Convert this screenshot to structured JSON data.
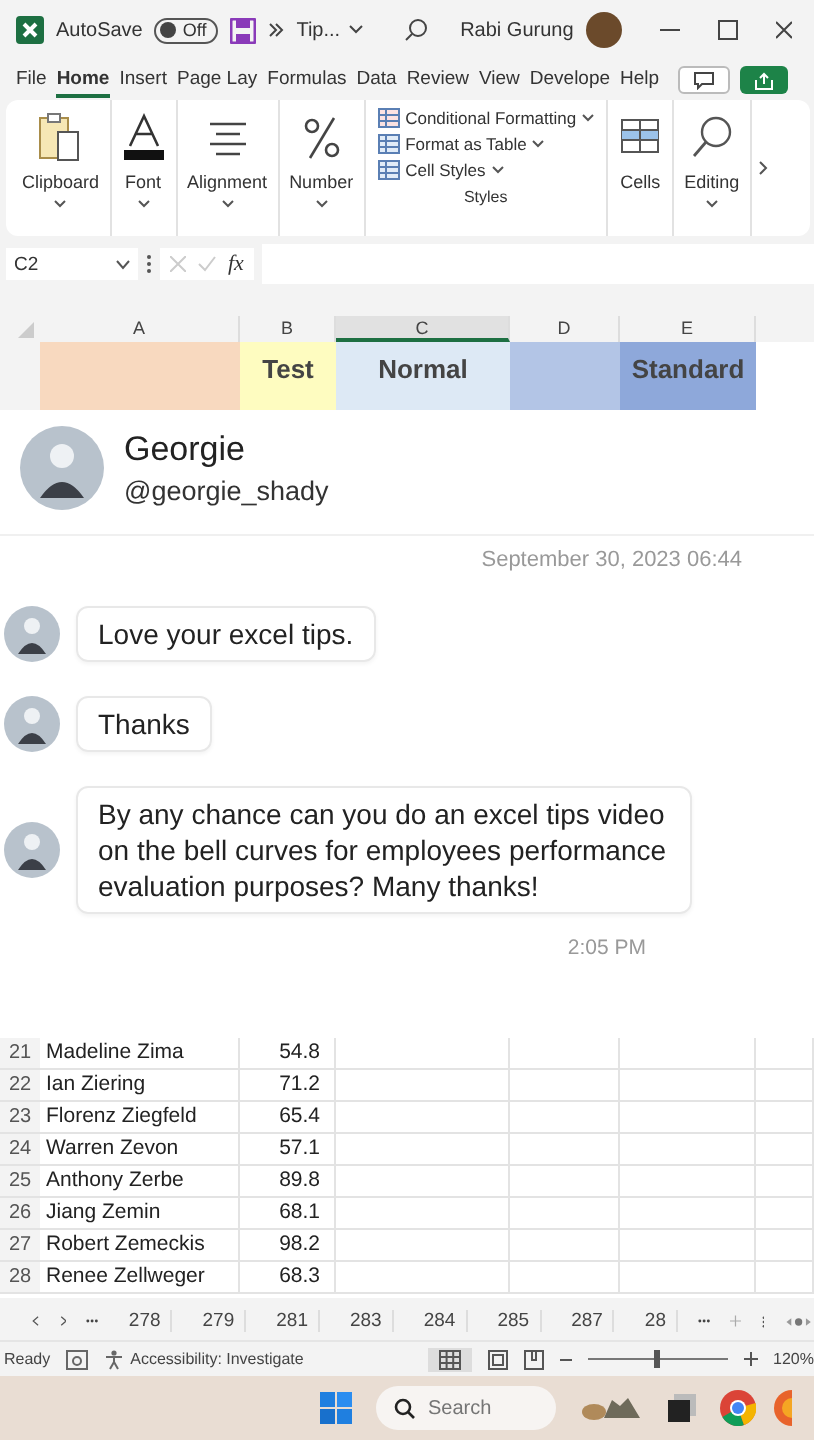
{
  "titlebar": {
    "autosave_label": "AutoSave",
    "autosave_toggle": {
      "label": "Off",
      "on": false
    },
    "filename": "Tip...",
    "user": "Rabi Gurung"
  },
  "menu_tabs": [
    {
      "label": "File",
      "selected": false
    },
    {
      "label": "Home",
      "selected": true
    },
    {
      "label": "Insert",
      "selected": false
    },
    {
      "label": "Page Lay",
      "selected": false
    },
    {
      "label": "Formulas",
      "selected": false
    },
    {
      "label": "Data",
      "selected": false
    },
    {
      "label": "Review",
      "selected": false
    },
    {
      "label": "View",
      "selected": false
    },
    {
      "label": "Develope",
      "selected": false
    },
    {
      "label": "Help",
      "selected": false
    }
  ],
  "ribbon": {
    "groups": [
      {
        "kind": "clipboard",
        "label": "Clipboard"
      },
      {
        "kind": "font",
        "label": "Font"
      },
      {
        "kind": "alignment",
        "label": "Alignment"
      },
      {
        "kind": "number",
        "label": "Number"
      }
    ],
    "styles": {
      "items": [
        "Conditional Formatting",
        "Format as Table",
        "Cell Styles"
      ],
      "label": "Styles"
    },
    "cells": "Cells",
    "editing": "Editing"
  },
  "formula_bar": {
    "name_box": "C2",
    "fx": "fx"
  },
  "sheet": {
    "columns": [
      {
        "label": "A",
        "selected": false
      },
      {
        "label": "B",
        "selected": false
      },
      {
        "label": "C",
        "selected": true
      },
      {
        "label": "D",
        "selected": false
      },
      {
        "label": "E",
        "selected": false
      }
    ],
    "header_row": {
      "cells": [
        {
          "color": "#f8d9bf"
        },
        {
          "text": "Test",
          "color": "#fefcc0"
        },
        {
          "text": "Normal",
          "color": "#dde9f5"
        },
        {
          "color": "#b3c5e6"
        },
        {
          "text": "Standard",
          "color": "#8ea8da"
        }
      ]
    },
    "rows": [
      {
        "number": "21",
        "name": "Madeline Zima",
        "value": "54.8"
      },
      {
        "number": "22",
        "name": "Ian Ziering",
        "value": "71.2"
      },
      {
        "number": "23",
        "name": "Florenz Ziegfeld",
        "value": "65.4"
      },
      {
        "number": "24",
        "name": "Warren Zevon",
        "value": "57.1"
      },
      {
        "number": "25",
        "name": "Anthony Zerbe",
        "value": "89.8"
      },
      {
        "number": "26",
        "name": "Jiang Zemin",
        "value": "68.1"
      },
      {
        "number": "27",
        "name": "Robert Zemeckis",
        "value": "98.2"
      },
      {
        "number": "28",
        "name": "Renee Zellweger",
        "value": "68.3"
      }
    ]
  },
  "chat": {
    "name": "Georgie",
    "handle": "@georgie_shady",
    "date": "September 30, 2023 06:44",
    "messages": [
      "Love your excel tips.",
      "Thanks",
      "By any chance can you do an excel tips video on the bell curves for employees performance evaluation purposes? Many thanks!"
    ],
    "time": "2:05 PM"
  },
  "sheet_tabs": [
    "278",
    "279",
    "281",
    "283",
    "284",
    "285",
    "287",
    "28"
  ],
  "status_bar": {
    "ready": "Ready",
    "accessibility": "Accessibility: Investigate",
    "zoom": {
      "level": 0.5,
      "reading": "120%"
    }
  },
  "taskbar": {
    "search_placeholder": "Search"
  }
}
